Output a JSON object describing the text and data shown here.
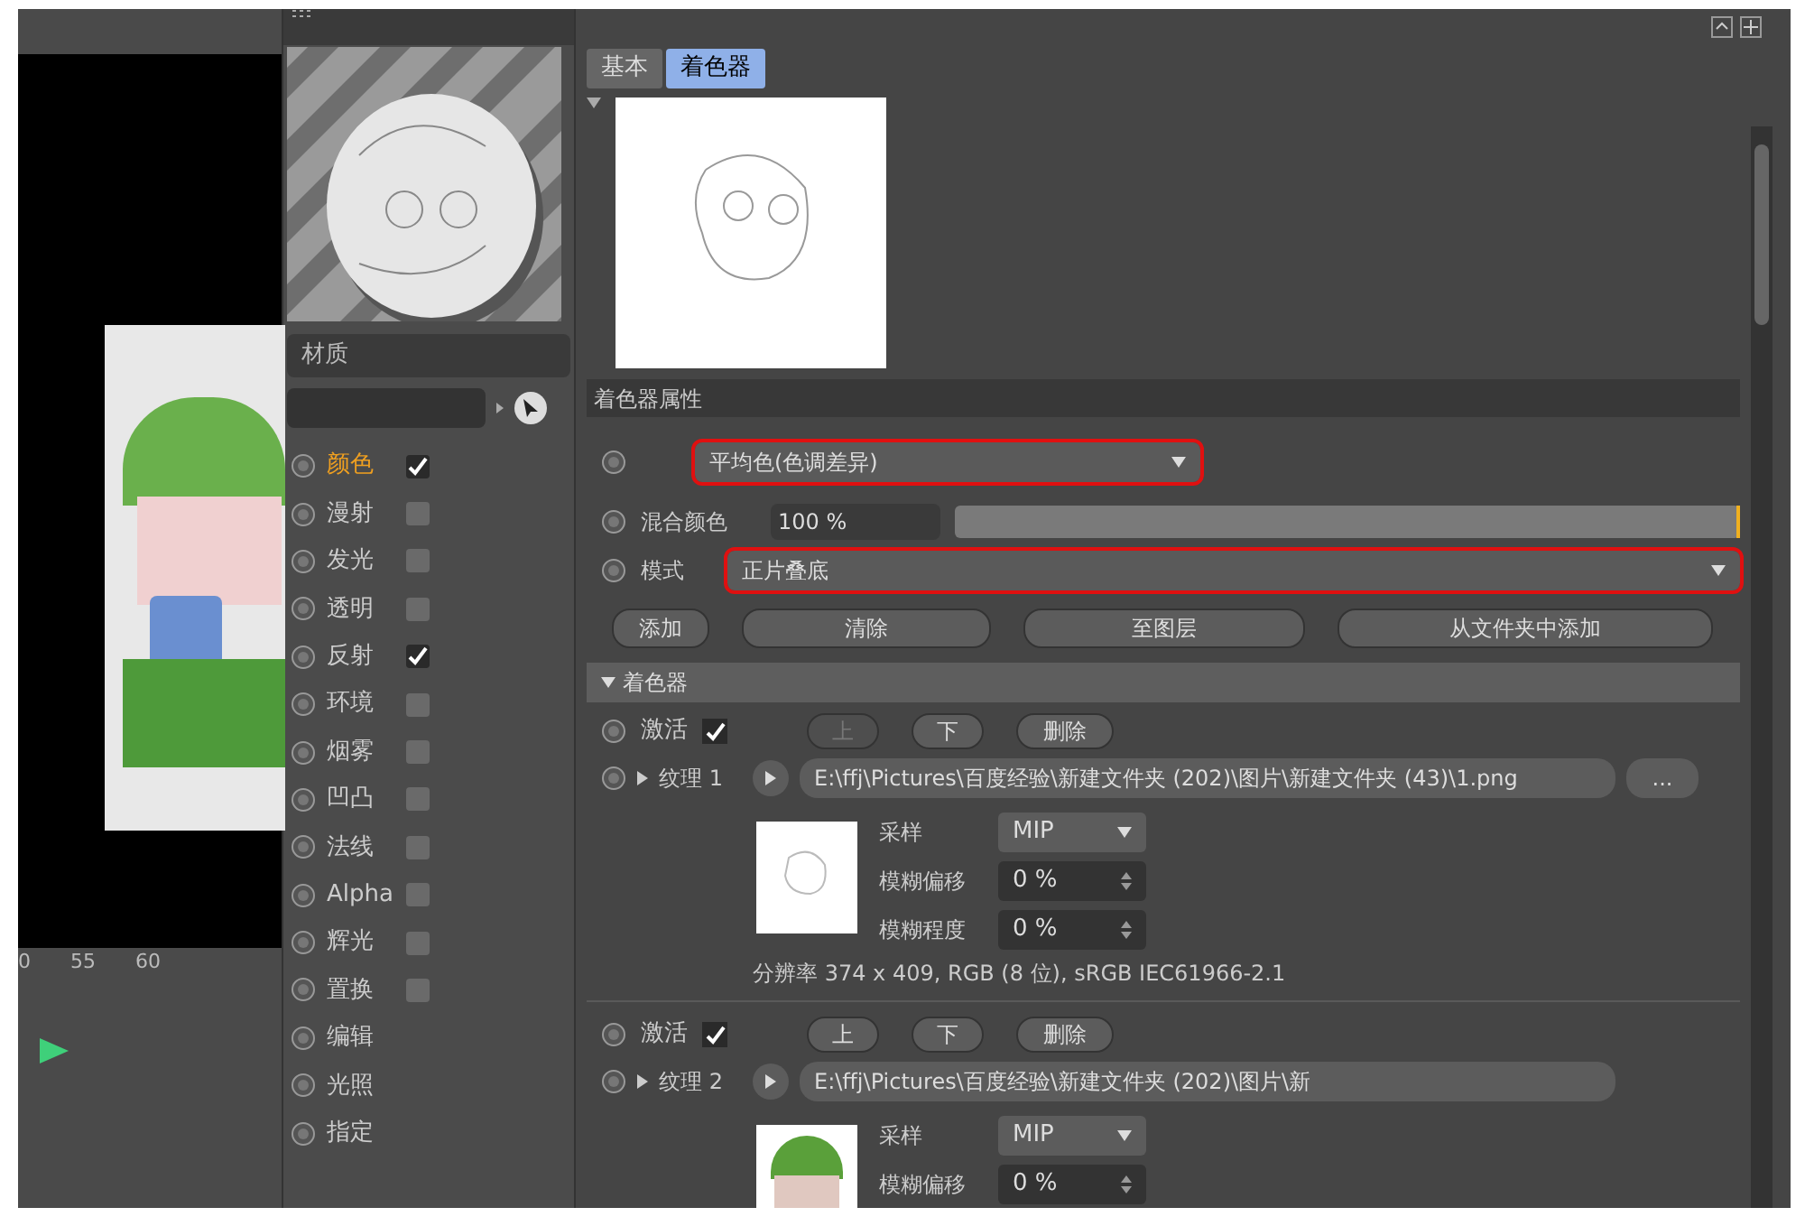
{
  "timeline": {
    "ticks": [
      "0",
      "55",
      "60"
    ]
  },
  "material": {
    "name": "材质",
    "channels": [
      {
        "label": "颜色",
        "kind": "toggle",
        "checked": true,
        "selected": true
      },
      {
        "label": "漫射",
        "kind": "toggle",
        "checked": false,
        "selected": false
      },
      {
        "label": "发光",
        "kind": "toggle",
        "checked": false,
        "selected": false
      },
      {
        "label": "透明",
        "kind": "toggle",
        "checked": false,
        "selected": false
      },
      {
        "label": "反射",
        "kind": "toggle",
        "checked": true,
        "selected": false
      },
      {
        "label": "环境",
        "kind": "toggle",
        "checked": false,
        "selected": false
      },
      {
        "label": "烟雾",
        "kind": "toggle",
        "checked": false,
        "selected": false
      },
      {
        "label": "凹凸",
        "kind": "toggle",
        "checked": false,
        "selected": false
      },
      {
        "label": "法线",
        "kind": "toggle",
        "checked": false,
        "selected": false
      },
      {
        "label": "Alpha",
        "kind": "toggle",
        "checked": false,
        "selected": false
      },
      {
        "label": "辉光",
        "kind": "toggle",
        "checked": false,
        "selected": false
      },
      {
        "label": "置换",
        "kind": "toggle",
        "checked": false,
        "selected": false
      },
      {
        "label": "编辑",
        "kind": "plain",
        "selected": false
      },
      {
        "label": "光照",
        "kind": "plain",
        "selected": false
      },
      {
        "label": "指定",
        "kind": "plain",
        "selected": false
      }
    ]
  },
  "tabs": [
    {
      "label": "基本",
      "selected": false
    },
    {
      "label": "着色器",
      "selected": true
    }
  ],
  "shader_properties": {
    "title": "着色器属性",
    "dropdown_1": {
      "value": "平均色(色调差异)",
      "highlighted": true
    },
    "blend": {
      "label": "混合颜色",
      "value": "100 %",
      "level": 1.0
    },
    "mode": {
      "label": "模式",
      "value": "正片叠底",
      "highlighted": true
    },
    "buttons": [
      "添加",
      "清除",
      "至图层",
      "从文件夹中添加"
    ]
  },
  "shader_section": {
    "title": "着色器",
    "expanded": true,
    "layers": [
      {
        "active_label": "激活",
        "active": true,
        "up": {
          "label": "上",
          "disabled": true
        },
        "down": "下",
        "delete": "删除",
        "texture_label": "纹理 1",
        "path": "E:\\ffj\\Pictures\\百度经验\\新建文件夹 (202)\\图片\\新建文件夹 (43)\\1.png",
        "browse": "...",
        "thumbnail": {
          "kind": "sketch"
        },
        "params": [
          {
            "label": "采样",
            "kind": "dropdown",
            "value": "MIP"
          },
          {
            "label": "模糊偏移",
            "kind": "spinner",
            "value": "0 %"
          },
          {
            "label": "模糊程度",
            "kind": "spinner",
            "value": "0 %"
          }
        ],
        "resolution": "分辨率 374 x 409, RGB (8 位), sRGB IEC61966-2.1"
      },
      {
        "active_label": "激活",
        "active": true,
        "up": {
          "label": "上",
          "disabled": false
        },
        "down": "下",
        "delete": "删除",
        "texture_label": "纹理 2",
        "path": "E:\\ffj\\Pictures\\百度经验\\新建文件夹 (202)\\图片\\新",
        "thumbnail": {
          "kind": "character"
        },
        "params": [
          {
            "label": "采样",
            "kind": "dropdown",
            "value": "MIP"
          },
          {
            "label": "模糊偏移",
            "kind": "spinner",
            "value": "0 %"
          }
        ]
      }
    ]
  }
}
